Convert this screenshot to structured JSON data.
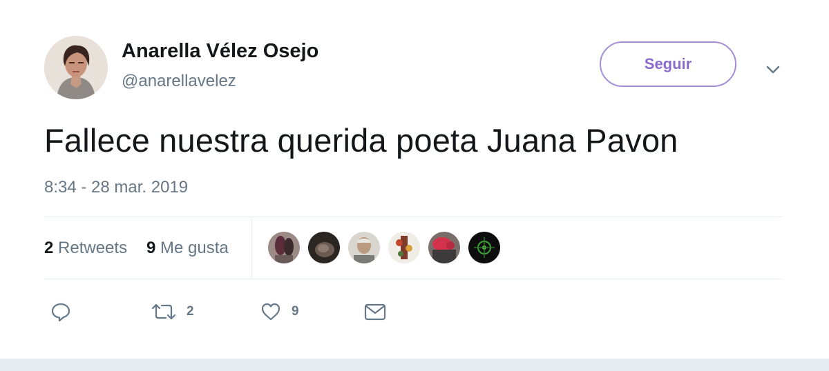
{
  "author": {
    "display_name": "Anarella Vélez Osejo",
    "handle": "@anarellavelez"
  },
  "follow_button": {
    "label": "Seguir"
  },
  "tweet": {
    "text": "Fallece nuestra querida poeta Juana Pavon",
    "timestamp": "8:34 - 28 mar. 2019"
  },
  "stats": {
    "retweets_count": "2",
    "retweets_label": "Retweets",
    "likes_count": "9",
    "likes_label": "Me gusta"
  },
  "actions": {
    "retweet_count": "2",
    "like_count": "9"
  },
  "colors": {
    "follow_accent": "#8b6ccc",
    "secondary_text": "#657786",
    "divider": "#e6ecf0"
  }
}
